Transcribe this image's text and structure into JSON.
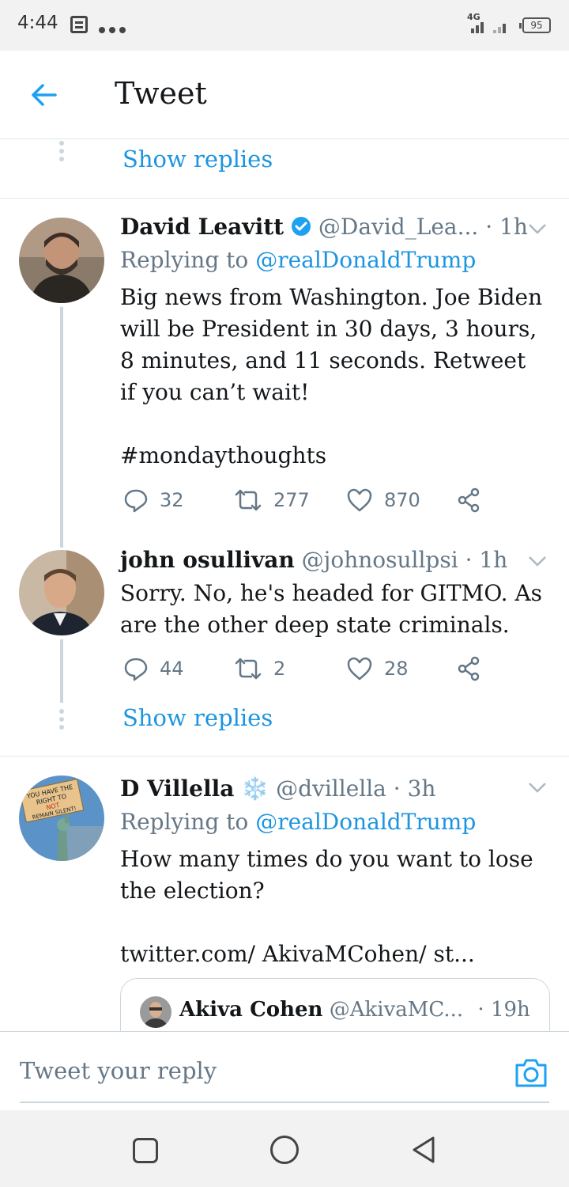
{
  "status_bar": {
    "time": "4:44",
    "network": "4G",
    "battery": "95",
    "icons": [
      "notification-icon",
      "more-dots-icon",
      "signal-icon",
      "battery-icon"
    ]
  },
  "header": {
    "title": "Tweet",
    "back_icon": "back-arrow-icon"
  },
  "thread": {
    "top_show_replies": "Show replies",
    "middle_show_replies": "Show replies"
  },
  "tweets": [
    {
      "name": "David Leavitt",
      "verified": true,
      "handle": "@David_Lea...",
      "time": "· 1h",
      "replying_prefix": "Replying to",
      "replying_to": "@realDonaldTrump",
      "text": "Big news from Washington. Joe Biden will be President in 30 days, 3 hours, 8 minutes, and 11 seconds. Retweet if you can’t wait!",
      "hashtag": "#mondaythoughts",
      "replies": "32",
      "retweets": "277",
      "likes": "870"
    },
    {
      "name": "john osullivan",
      "handle": "@johnosullpsi",
      "time": "· 1h",
      "text": "Sorry. No, he's headed for GITMO. As are the other deep state criminals.",
      "replies": "44",
      "retweets": "2",
      "likes": "28"
    },
    {
      "name": "D Villella",
      "name_emoji": "❄️",
      "handle": "@dvillella",
      "time": "· 3h",
      "replying_prefix": "Replying to",
      "replying_to": "@realDonaldTrump",
      "text": "How many times do you want to lose the election?",
      "link": "twitter.com/ AkivaMCohen/ st...",
      "quote": {
        "name": "Akiva Cohen",
        "handle": "@AkivaMC...",
        "time": "· 19h"
      },
      "avatar_sign_text": "YOU HAVE THE RIGHT TO NOT REMAIN SILENT!"
    }
  ],
  "reply_bar": {
    "placeholder": "Tweet your reply",
    "camera_icon": "camera-icon"
  },
  "colors": {
    "accent": "#1da1f2",
    "link": "#1b95e0",
    "muted": "#657786",
    "divider": "#e1e8ed"
  }
}
